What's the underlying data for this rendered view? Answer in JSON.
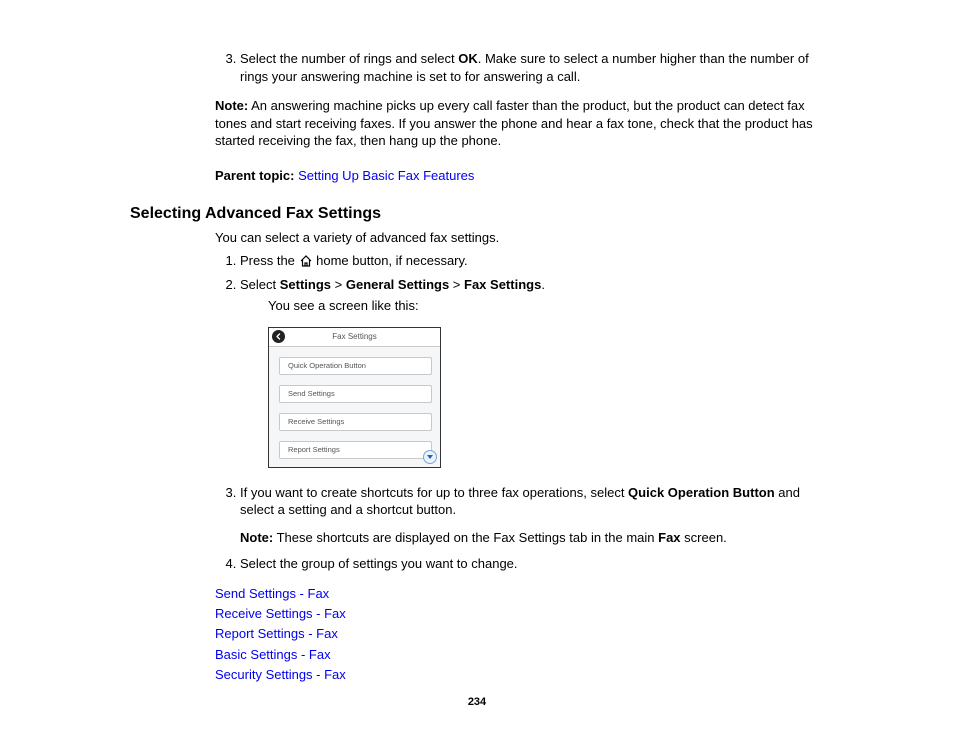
{
  "top_list": {
    "start": 3,
    "item3_a": "Select the number of rings and select ",
    "item3_bold": "OK",
    "item3_b": ". Make sure to select a number higher than the number of rings your answering machine is set to for answering a call."
  },
  "note1": {
    "label": "Note:",
    "body": " An answering machine picks up every call faster than the product, but the product can detect fax tones and start receiving faxes. If you answer the phone and hear a fax tone, check that the product has started receiving the fax, then hang up the phone."
  },
  "parent_topic": {
    "label": "Parent topic:",
    "link": "Setting Up Basic Fax Features"
  },
  "heading": "Selecting Advanced Fax Settings",
  "intro": "You can select a variety of advanced fax settings.",
  "steps": {
    "s1_a": "Press the ",
    "s1_b": " home button, if necessary.",
    "s2_a": "Select ",
    "s2_b1": "Settings",
    "s2_sep1": " > ",
    "s2_b2": "General Settings",
    "s2_sep2": " > ",
    "s2_b3": "Fax Settings",
    "s2_end": ".",
    "s2_sub": "You see a screen like this:",
    "s3_a": "If you want to create shortcuts for up to three fax operations, select ",
    "s3_bold": "Quick Operation Button",
    "s3_b": " and select a setting and a shortcut button.",
    "s3_note_label": "Note:",
    "s3_note_a": " These shortcuts are displayed on the Fax Settings tab in the main ",
    "s3_note_bold": "Fax",
    "s3_note_b": " screen.",
    "s4": "Select the group of settings you want to change."
  },
  "figure": {
    "title": "Fax Settings",
    "rows": [
      "Quick Operation Button",
      "Send Settings",
      "Receive Settings",
      "Report Settings"
    ]
  },
  "sublinks": [
    "Send Settings - Fax",
    "Receive Settings - Fax",
    "Report Settings - Fax",
    "Basic Settings - Fax",
    "Security Settings - Fax"
  ],
  "page_number": "234"
}
